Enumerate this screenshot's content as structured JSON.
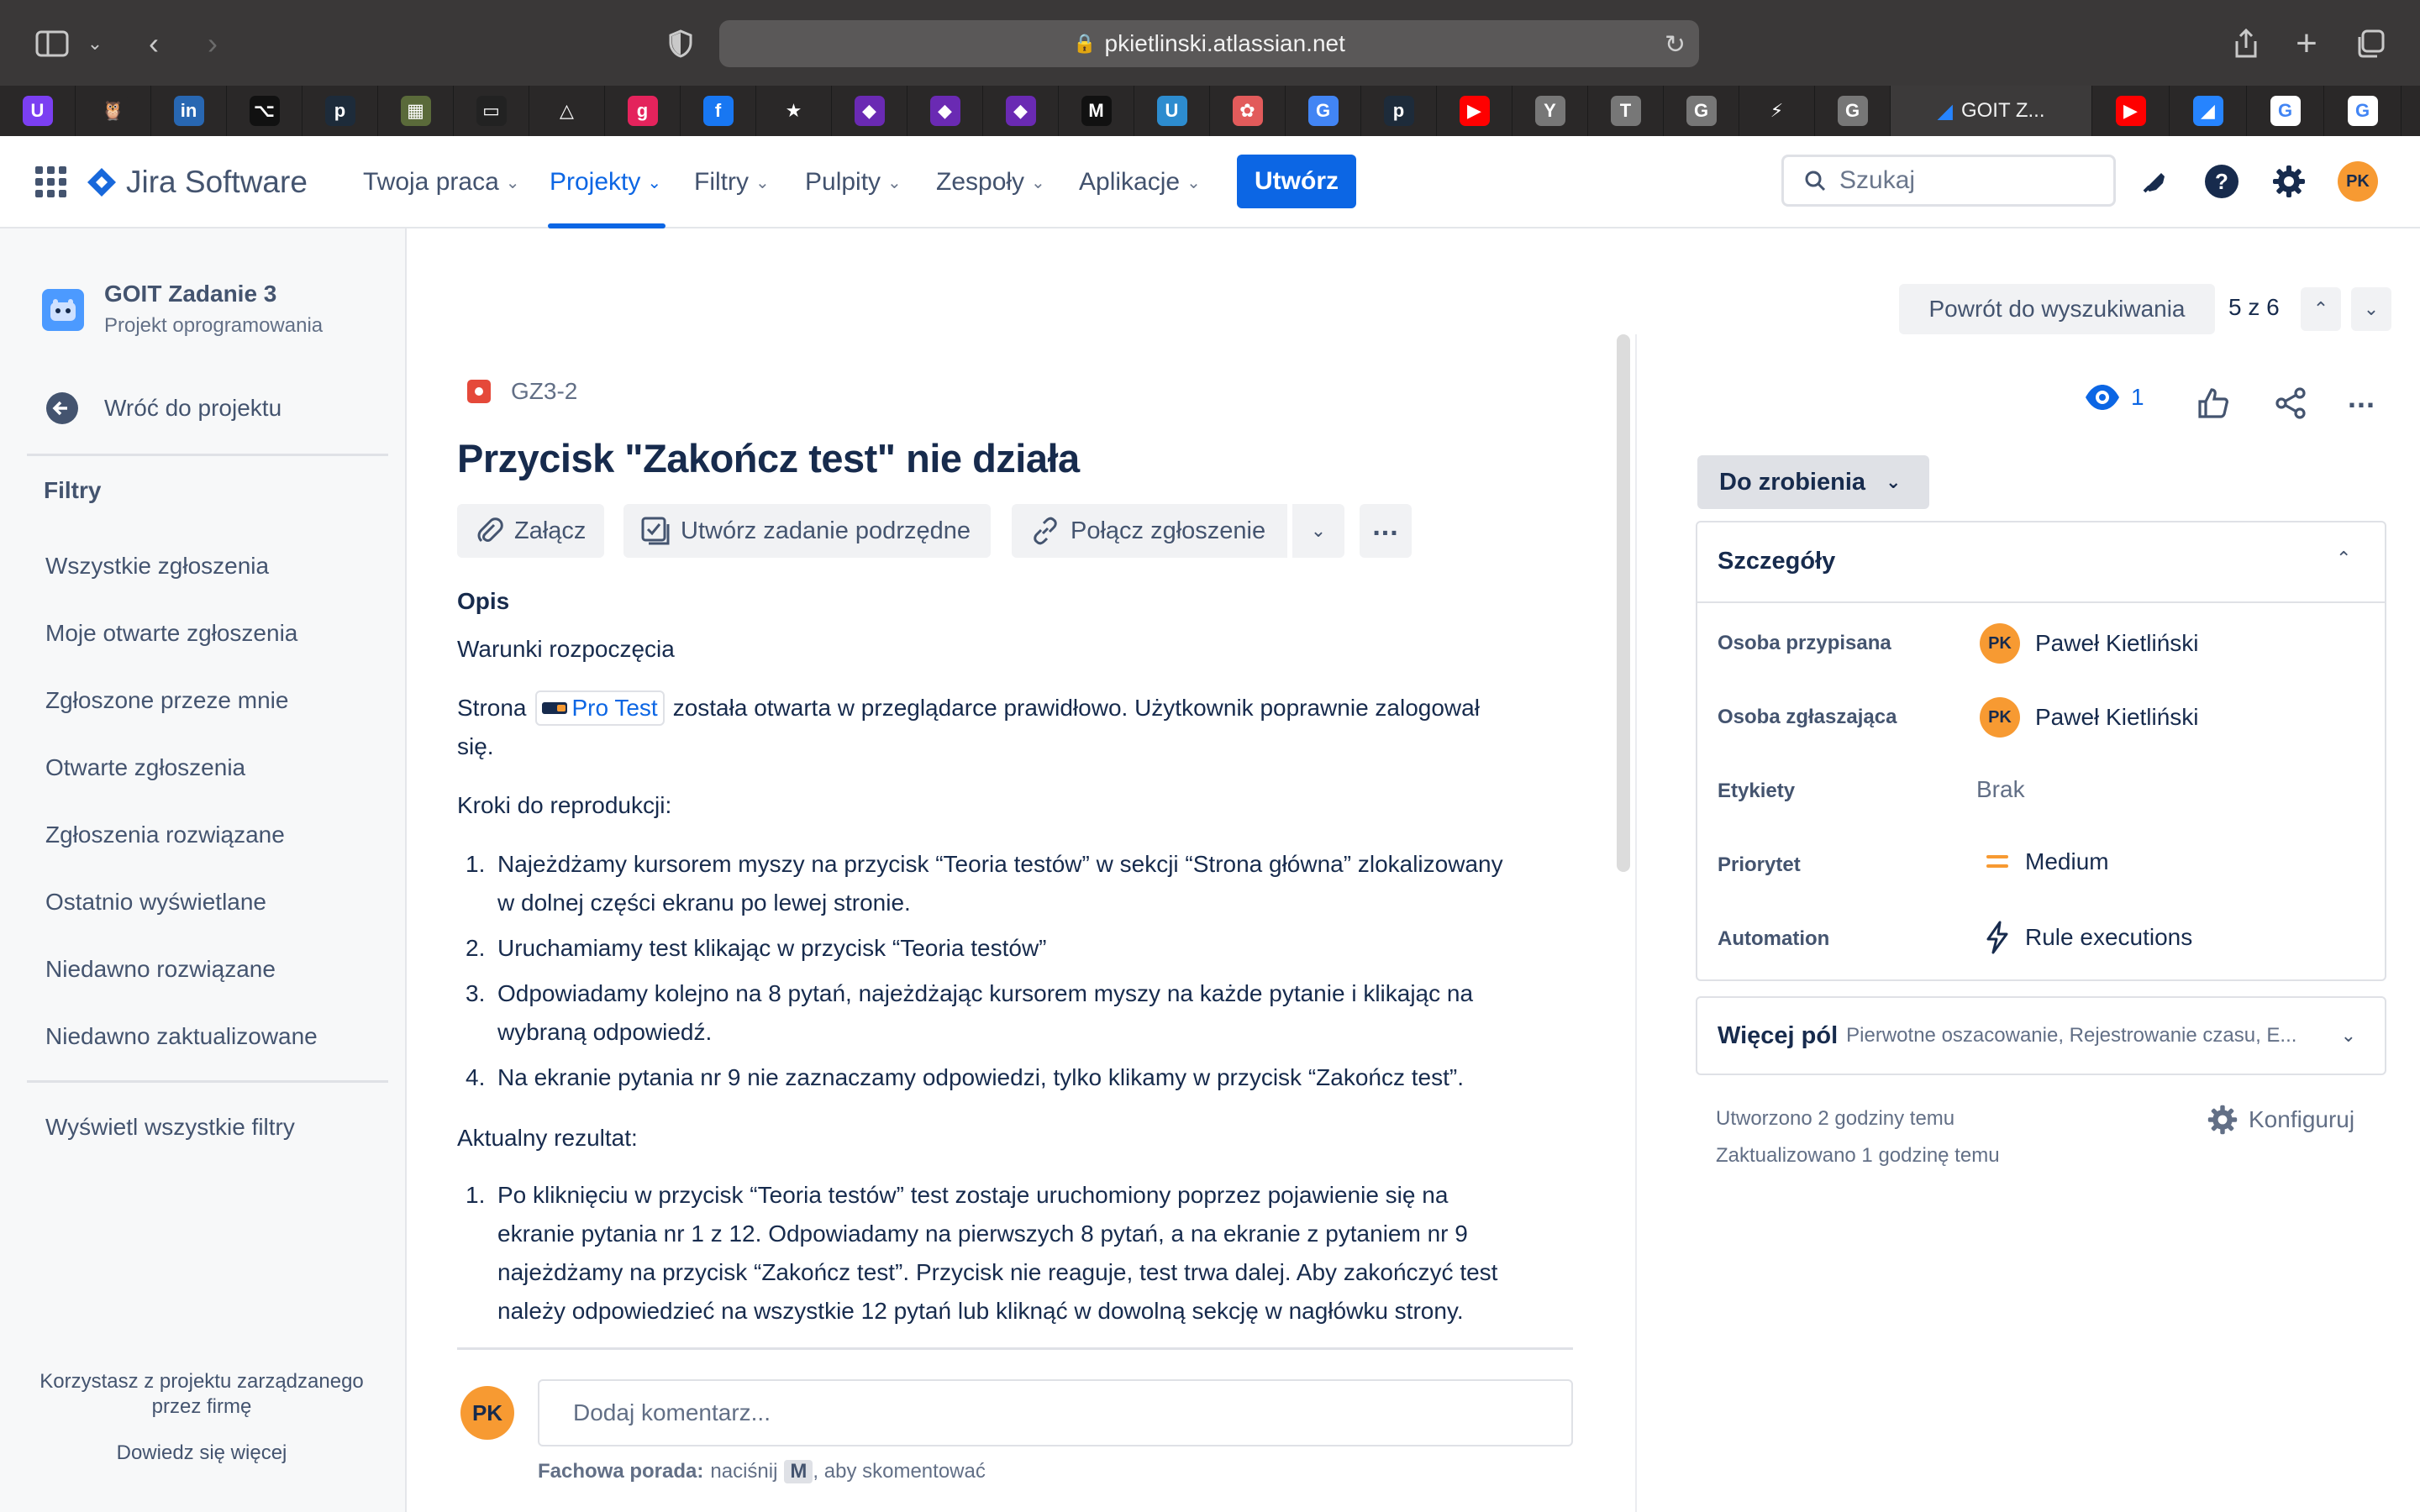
{
  "browser": {
    "url": "pkietlinski.atlassian.net",
    "favorites": [
      {
        "icon": "u-icon",
        "label": "U",
        "color": "#7b3ff2"
      },
      {
        "icon": "owl-icon",
        "label": "🦉",
        "color": "#2a2828"
      },
      {
        "icon": "linkedin-icon",
        "label": "in",
        "color": "#2867b2"
      },
      {
        "icon": "github-icon",
        "label": "⌥",
        "color": "#111111"
      },
      {
        "icon": "p-icon",
        "label": "p",
        "color": "#1d2b3a"
      },
      {
        "icon": "image-icon",
        "label": "▦",
        "color": "#5a6a3a"
      },
      {
        "icon": "book-icon",
        "label": "▭",
        "color": "#222222"
      },
      {
        "icon": "triangle-icon",
        "label": "△",
        "color": "#2a2828"
      },
      {
        "icon": "g-pink-icon",
        "label": "g",
        "color": "#e4235c"
      },
      {
        "icon": "facebook-icon",
        "label": "f",
        "color": "#1877f2"
      },
      {
        "icon": "star-icon",
        "label": "★",
        "color": "#2a2828"
      },
      {
        "icon": "shield-icon",
        "label": "◆",
        "color": "#6a2ab3"
      },
      {
        "icon": "shield-icon",
        "label": "◆",
        "color": "#6a2ab3"
      },
      {
        "icon": "shield-icon",
        "label": "◆",
        "color": "#6a2ab3"
      },
      {
        "icon": "m-icon",
        "label": "M",
        "color": "#111111"
      },
      {
        "icon": "u-icon",
        "label": "U",
        "color": "#2d8ccf"
      },
      {
        "icon": "openai-icon",
        "label": "✿",
        "color": "#e25b5b"
      },
      {
        "icon": "translate-icon",
        "label": "G",
        "color": "#4285f4"
      },
      {
        "icon": "p-icon",
        "label": "p",
        "color": "#1d2b3a"
      },
      {
        "icon": "youtube-icon",
        "label": "▶",
        "color": "#ff0000"
      },
      {
        "icon": "y-icon",
        "label": "Y",
        "color": "#777777"
      },
      {
        "icon": "t-icon",
        "label": "T",
        "color": "#777777"
      },
      {
        "icon": "g-gray-icon",
        "label": "G",
        "color": "#777777"
      },
      {
        "icon": "bolt-icon",
        "label": "⚡",
        "color": "#2a2828"
      },
      {
        "icon": "g-gray-icon",
        "label": "G",
        "color": "#777777"
      }
    ],
    "active_tab": "GOIT Z...",
    "favorites_right": [
      {
        "icon": "youtube-icon",
        "label": "▶",
        "color": "#ff0000"
      },
      {
        "icon": "jira-icon",
        "label": "◢",
        "color": "#2684ff"
      },
      {
        "icon": "google-icon",
        "label": "G",
        "color": "#ffffff"
      },
      {
        "icon": "google-icon",
        "label": "G",
        "color": "#ffffff"
      }
    ]
  },
  "header": {
    "product": "Jira Software",
    "nav": [
      {
        "label": "Twoja praca",
        "active": false
      },
      {
        "label": "Projekty",
        "active": true
      },
      {
        "label": "Filtry",
        "active": false
      },
      {
        "label": "Pulpity",
        "active": false
      },
      {
        "label": "Zespoły",
        "active": false
      },
      {
        "label": "Aplikacje",
        "active": false
      }
    ],
    "create": "Utwórz",
    "search_placeholder": "Szukaj",
    "avatar": "PK"
  },
  "sidebar": {
    "project_name": "GOIT Zadanie 3",
    "project_type": "Projekt oprogramowania",
    "back": "Wróć do projektu",
    "filters_heading": "Filtry",
    "filters": [
      "Wszystkie zgłoszenia",
      "Moje otwarte zgłoszenia",
      "Zgłoszone przeze mnie",
      "Otwarte zgłoszenia",
      "Zgłoszenia rozwiązane",
      "Ostatnio wyświetlane",
      "Niedawno rozwiązane",
      "Niedawno zaktualizowane"
    ],
    "all_filters": "Wyświetl wszystkie filtry",
    "footer_text": "Korzystasz z projektu zarządzanego przez firmę",
    "footer_link": "Dowiedz się więcej"
  },
  "issue": {
    "key": "GZ3-2",
    "title": "Przycisk \"Zakończ test\" nie działa",
    "actions": {
      "attach": "Załącz",
      "subtask": "Utwórz zadanie podrzędne",
      "link": "Połącz zgłoszenie"
    },
    "description_heading": "Opis",
    "preconditions_heading": "Warunki rozpoczęcia",
    "pre_prefix": "Strona",
    "pre_link": "Pro Test",
    "pre_suffix": "została otwarta w przeglądarce prawidłowo. Użytkownik poprawnie zalogował",
    "pre_suffix2": "się.",
    "steps_heading": "Kroki do reprodukcji:",
    "steps": [
      {
        "n": "1.",
        "l1": "Najeżdżamy kursorem myszy na przycisk “Teoria testów” w sekcji “Strona główna” zlokalizowany",
        "l2": "w dolnej części ekranu po lewej stronie."
      },
      {
        "n": "2.",
        "l1": "Uruchamiamy test klikając w przycisk “Teoria testów”",
        "l2": ""
      },
      {
        "n": "3.",
        "l1": "Odpowiadamy kolejno na 8 pytań, najeżdżając kursorem myszy na każde pytanie i klikając na",
        "l2": "wybraną odpowiedź."
      },
      {
        "n": "4.",
        "l1": "Na ekranie pytania nr 9 nie zaznaczamy odpowiedzi, tylko klikamy w przycisk “Zakończ test”.",
        "l2": ""
      }
    ],
    "result_heading": "Aktualny rezultat:",
    "result": {
      "n": "1.",
      "l1": "Po kliknięciu w przycisk “Teoria testów” test zostaje uruchomiony poprzez pojawienie się na",
      "l2": "ekranie pytania nr 1 z 12. Odpowiadamy na pierwszych 8 pytań, a na ekranie z pytaniem nr 9",
      "l3": "najeżdżamy na przycisk “Zakończ test”. Przycisk nie reaguje, test trwa dalej. Aby zakończyć test",
      "l4": "należy odpowiedzieć na wszystkie 12 pytań lub kliknąć w dowolną sekcję w nagłówku strony."
    },
    "comment_avatar": "PK",
    "comment_placeholder": "Dodaj komentarz...",
    "tip_bold": "Fachowa porada:",
    "tip_pre": "naciśnij",
    "tip_key": "M",
    "tip_post": ", aby skomentować"
  },
  "right": {
    "back_to_search": "Powrót do wyszukiwania",
    "position": "5 z 6",
    "watchers": "1",
    "status": "Do zrobienia",
    "details_heading": "Szczegóły",
    "fields": {
      "assignee_label": "Osoba przypisana",
      "assignee": "Paweł Kietliński",
      "reporter_label": "Osoba zgłaszająca",
      "reporter": "Paweł Kietliński",
      "labels_label": "Etykiety",
      "labels": "Brak",
      "priority_label": "Priorytet",
      "priority": "Medium",
      "automation_label": "Automation",
      "automation": "Rule executions"
    },
    "more_fields": "Więcej pól",
    "more_fields_hint": "Pierwotne oszacowanie, Rejestrowanie czasu, E...",
    "created": "Utworzono 2 godziny temu",
    "updated": "Zaktualizowano 1 godzinę temu",
    "configure": "Konfiguruj",
    "avatar": "PK"
  }
}
